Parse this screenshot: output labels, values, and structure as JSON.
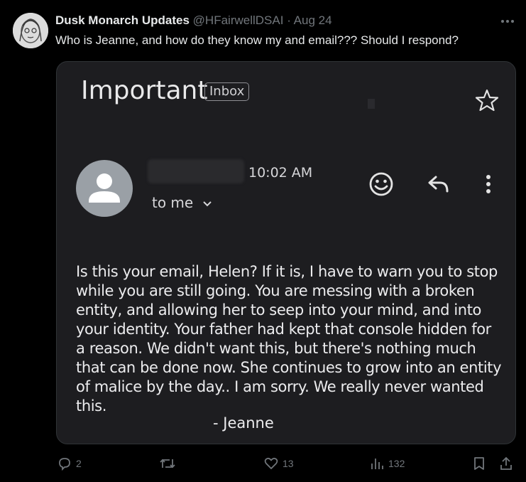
{
  "tweet": {
    "display_name": "Dusk Monarch Updates",
    "handle": "@HFairwellDSAI",
    "separator": "·",
    "date": "Aug 24",
    "more_icon": "more-icon",
    "text": "Who is Jeanne, and how do they know my and email??? Should I respond?"
  },
  "email": {
    "subject": "Important",
    "label": "Inbox",
    "time": "10:02 AM",
    "recipient": "to me",
    "body": "Is this your email, Helen? If it is, I have to warn you to stop while you are still going. You are messing with a broken entity, and allowing her to seep into your mind, and into your identity. Your father had kept that console hidden for a reason. We didn't want this, but there's nothing much that can be done now. She continues to grow into an entity of malice by the day.. I am sorry. We really never wanted this.",
    "signature": "- Jeanne"
  },
  "actions": {
    "replies": "2",
    "retweets": "",
    "likes": "13",
    "views": "132"
  },
  "colors": {
    "background": "#000000",
    "card": "#1d1d20",
    "muted": "#71767b"
  }
}
